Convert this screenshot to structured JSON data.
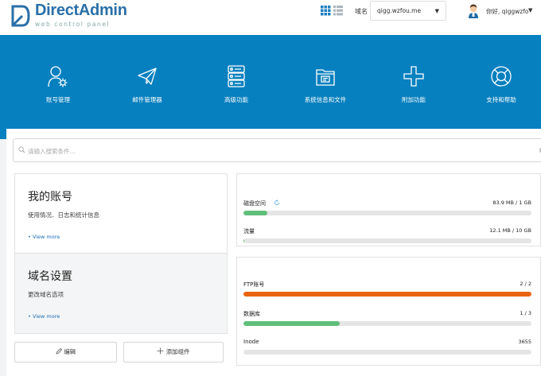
{
  "header": {
    "logo_text": "DirectAdmin",
    "logo_subtitle": "web control panel",
    "domain_label": "域名",
    "domain_value": "qigg.wzfou.me",
    "greeting": "你好, qiggwzfo"
  },
  "nav": {
    "items": [
      {
        "label": "账号管理",
        "icon": "user-gear-icon"
      },
      {
        "label": "邮件管理器",
        "icon": "paper-plane-icon"
      },
      {
        "label": "高级功能",
        "icon": "server-icon"
      },
      {
        "label": "系统信息和文件",
        "icon": "folder-icon"
      },
      {
        "label": "附加功能",
        "icon": "plus-icon"
      },
      {
        "label": "支持和帮助",
        "icon": "lifebuoy-icon"
      }
    ]
  },
  "search": {
    "placeholder": "请输入搜索条件..."
  },
  "cards": [
    {
      "title": "我的账号",
      "desc": "使用情况、日志和统计信息",
      "more": "• View more"
    },
    {
      "title": "域名设置",
      "desc": "更改域名选项",
      "more": "• View more"
    }
  ],
  "buttons": {
    "edit": "编辑",
    "add_widget": "添加组件"
  },
  "stats": {
    "disk": {
      "name": "磁盘空间",
      "value": "83.9 MB / 1 GB",
      "percent": 8.2
    },
    "bandwidth": {
      "name": "流量",
      "value": "12.1 MB / 10 GB",
      "percent": 0.1
    },
    "ftp": {
      "name": "FTP账号",
      "value": "2 / 2",
      "percent": 100
    },
    "db": {
      "name": "数据库",
      "value": "1 / 3",
      "percent": 33.3
    },
    "inode": {
      "name": "Inode",
      "value": "3655",
      "percent": 0
    }
  },
  "colors": {
    "brand": "#2a6fa8",
    "hero": "#0780bf",
    "green": "#5fbf7a",
    "orange": "#e8640e",
    "link": "#1a6fb5"
  }
}
